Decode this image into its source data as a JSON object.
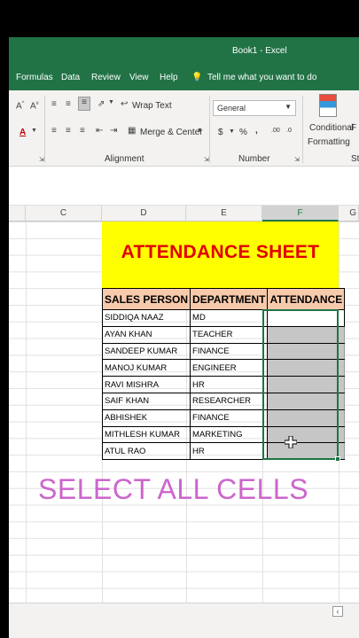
{
  "window": {
    "title": "Book1  -  Excel"
  },
  "menu": {
    "formulas": "Formulas",
    "data": "Data",
    "review": "Review",
    "view": "View",
    "help": "Help",
    "tell_me": "Tell me what you want to do"
  },
  "ribbon": {
    "wrap_text": "Wrap Text",
    "merge_center": "Merge & Center",
    "alignment_group": "Alignment",
    "number_format": "General",
    "number_group": "Number",
    "conditional": "Conditional",
    "formatting": "Formatting",
    "partial_f": "F",
    "partial_st": "St",
    "currency": "$",
    "percent": "%",
    "comma": ",",
    "inc_dec": ".00",
    "dec_dec": ".0"
  },
  "columns": {
    "c": "C",
    "d": "D",
    "e": "E",
    "f": "F",
    "g": "G"
  },
  "sheet": {
    "banner": "ATTENDANCE SHEET",
    "headers": [
      "SALES PERSON",
      "DEPARTMENT",
      "ATTENDANCE"
    ],
    "rows": [
      [
        "SIDDIQA NAAZ",
        "MD",
        ""
      ],
      [
        "AYAN KHAN",
        "TEACHER",
        ""
      ],
      [
        "SANDEEP KUMAR",
        "FINANCE",
        ""
      ],
      [
        "MANOJ KUMAR",
        "ENGINEER",
        ""
      ],
      [
        "RAVI MISHRA",
        "HR",
        ""
      ],
      [
        "SAIF KHAN",
        "RESEARCHER",
        ""
      ],
      [
        "ABHISHEK",
        "FINANCE",
        ""
      ],
      [
        "MITHLESH KUMAR",
        "MARKETING",
        ""
      ],
      [
        "ATUL RAO",
        "HR",
        ""
      ]
    ]
  },
  "overlay": {
    "caption": "SELECT ALL CELLS"
  },
  "colors": {
    "excel_green": "#217346",
    "banner_bg": "#ffff00",
    "banner_text": "#e00000",
    "header_bg": "#f7caac",
    "selection": "#c6c6c6",
    "caption": "#cc66cc"
  }
}
